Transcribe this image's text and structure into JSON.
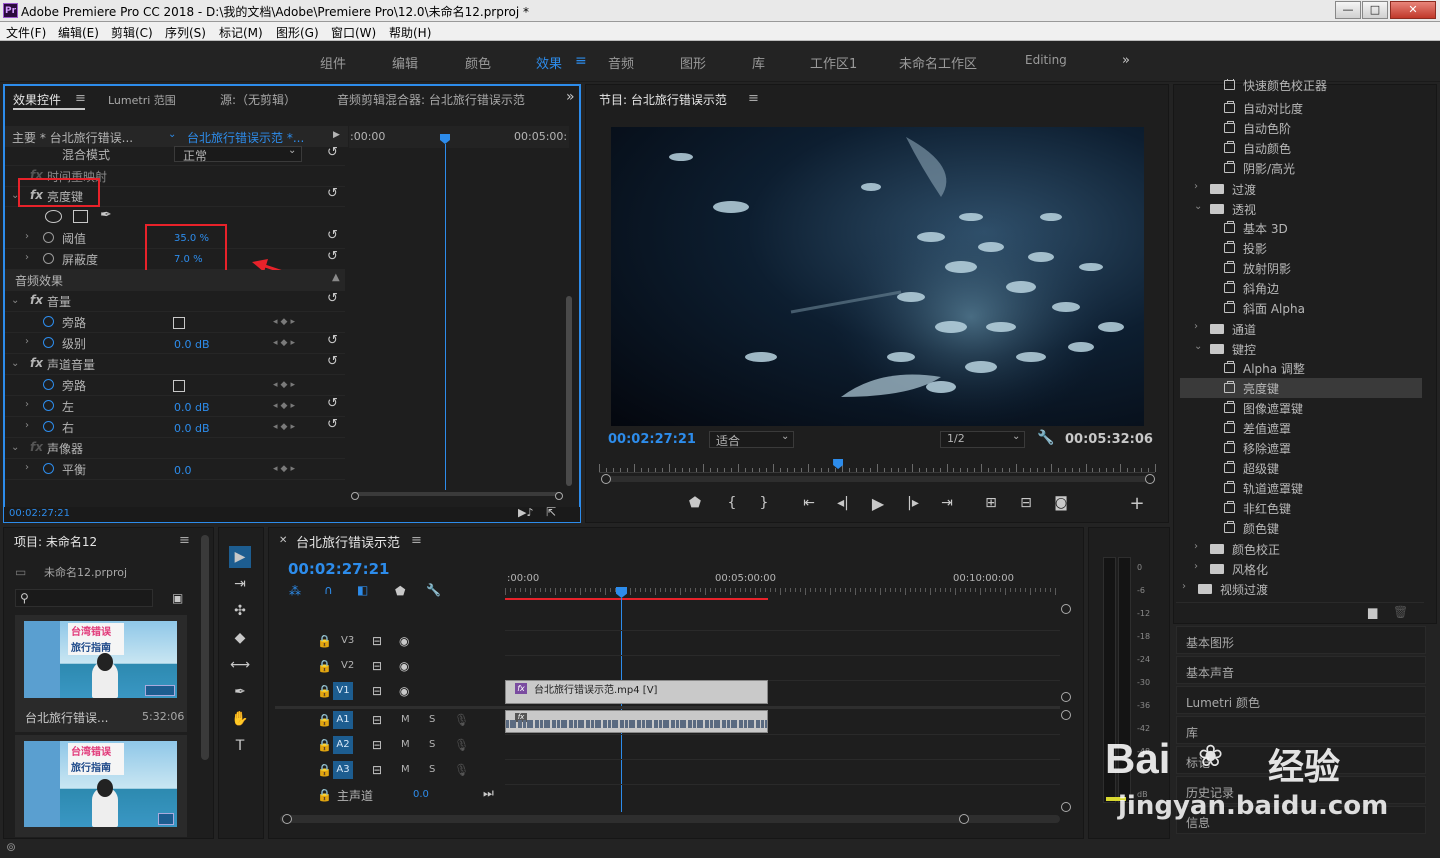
{
  "window": {
    "title": "Adobe Premiere Pro CC 2018 - D:\\我的文档\\Adobe\\Premiere Pro\\12.0\\未命名12.prproj *",
    "app_icon": "Pr",
    "min": "—",
    "max": "□",
    "close": "✕"
  },
  "menu": [
    "文件(F)",
    "编辑(E)",
    "剪辑(C)",
    "序列(S)",
    "标记(M)",
    "图形(G)",
    "窗口(W)",
    "帮助(H)"
  ],
  "workspaces": [
    "组件",
    "编辑",
    "颜色",
    "效果",
    "音频",
    "图形",
    "库",
    "工作区1",
    "未命名工作区",
    "Editing"
  ],
  "active_workspace": "效果",
  "effect_controls": {
    "tabs": [
      "效果控件",
      "Lumetri 范围",
      "源:（无剪辑）",
      "音频剪辑混合器: 台北旅行错误示范"
    ],
    "master_clip": "主要 * 台北旅行错误...",
    "seq_clip": "台北旅行错误示范 *...",
    "time_start": ":00:00",
    "time_end": "00:05:00:",
    "blend_label": "混合模式",
    "blend_value": "正常",
    "time_remap": "时间重映射",
    "luma_key": "亮度键",
    "threshold_label": "阈值",
    "threshold_value": "35.0 %",
    "cutoff_label": "屏蔽度",
    "cutoff_value": "7.0 %",
    "audio_effects": "音频效果",
    "volume": "音量",
    "bypass": "旁路",
    "level": "级别",
    "level_value": "0.0 dB",
    "channel_volume": "声道音量",
    "bypass2": "旁路",
    "left": "左",
    "left_value": "0.0 dB",
    "right": "右",
    "right_value": "0.0 dB",
    "panner": "声像器",
    "balance": "平衡",
    "balance_value": "0.0",
    "current_time": "00:02:27:21"
  },
  "program": {
    "title": "节目: 台北旅行错误示范",
    "timecode": "00:02:27:21",
    "fit": "适合",
    "resolution": "1/2",
    "duration": "00:05:32:06",
    "playhead_fraction": 0.43
  },
  "effects_list": {
    "items_top": [
      "快速颜色校正器",
      "自动对比度",
      "自动色阶",
      "自动颜色",
      "阴影/高光"
    ],
    "folder_transition": "过渡",
    "folder_perspective": "透视",
    "perspective_items": [
      "基本 3D",
      "投影",
      "放射阴影",
      "斜角边",
      "斜面 Alpha"
    ],
    "folder_channel": "通道",
    "folder_keying": "键控",
    "keying_items": [
      "Alpha 调整",
      "亮度键",
      "图像遮罩键",
      "差值遮罩",
      "移除遮罩",
      "超级键",
      "轨道遮罩键",
      "非红色键",
      "颜色键"
    ],
    "selected": "亮度键",
    "folder_color": "颜色校正",
    "folder_stylize": "风格化",
    "folder_video_trans": "视频过渡",
    "collapsed_panels": [
      "基本图形",
      "基本声音",
      "Lumetri 颜色",
      "库",
      "标记",
      "历史记录",
      "信息"
    ]
  },
  "project": {
    "title": "项目: 未命名12",
    "file": "未命名12.prproj",
    "clip_name": "台北旅行错误...",
    "clip_duration": "5:32:06",
    "thumb_text1": "台湾错误",
    "thumb_text2": "旅行指南"
  },
  "timeline": {
    "title": "台北旅行错误示范",
    "timecode": "00:02:27:21",
    "ruler": [
      ":00:00",
      "00:05:00:00",
      "00:10:00:00"
    ],
    "tracks_video": [
      "V3",
      "V2",
      "V1"
    ],
    "tracks_audio": [
      "A1",
      "A2",
      "A3"
    ],
    "master": "主声道",
    "master_value": "0.0",
    "clip_label": "台北旅行错误示范.mp4 [V]",
    "m": "M",
    "s": "S"
  },
  "meter_scale": [
    "0",
    "-6",
    "-12",
    "-18",
    "-24",
    "-30",
    "-36",
    "-42",
    "-48",
    "dB"
  ],
  "watermark": {
    "brand": "Bai",
    "brand2": "经验",
    "url": "jingyan.baidu.com"
  },
  "colors": {
    "accent": "#2d8ceb",
    "annotation": "#e8222a"
  }
}
